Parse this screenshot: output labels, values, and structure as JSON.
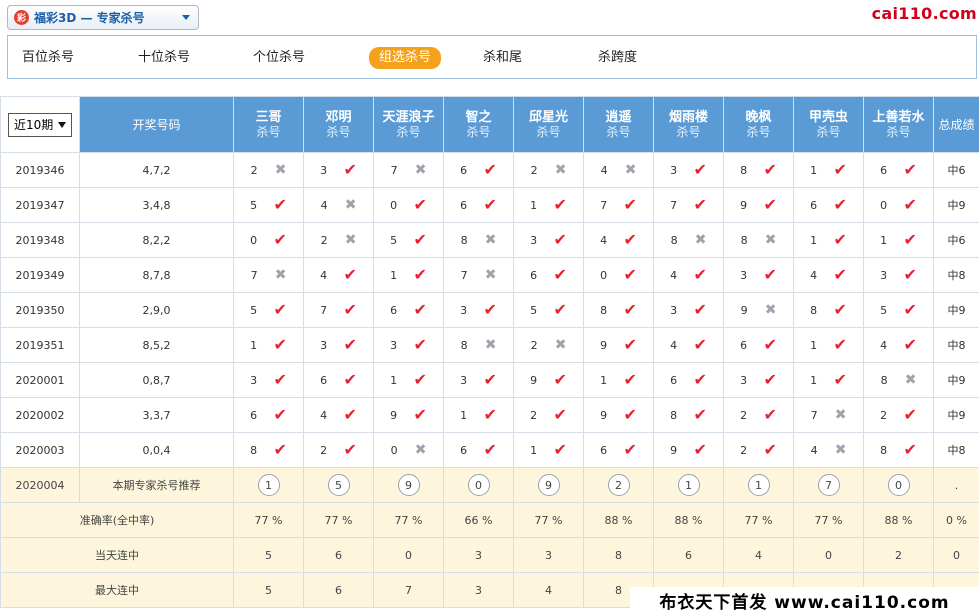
{
  "header": {
    "logo_char": "彩",
    "selector_title": "福彩3D — 专家杀号",
    "brand": "cai110.com"
  },
  "tabs": [
    {
      "label": "百位杀号",
      "active": false
    },
    {
      "label": "十位杀号",
      "active": false
    },
    {
      "label": "个位杀号",
      "active": false
    },
    {
      "label": "组选杀号",
      "active": true
    },
    {
      "label": "杀和尾",
      "active": false
    },
    {
      "label": "杀跨度",
      "active": false
    }
  ],
  "table": {
    "period_select": "近10期",
    "draw_header": "开奖号码",
    "total_header": "总成绩",
    "experts": [
      {
        "name": "三哥",
        "sub": "杀号"
      },
      {
        "name": "邓明",
        "sub": "杀号"
      },
      {
        "name": "天涯浪子",
        "sub": "杀号"
      },
      {
        "name": "智之",
        "sub": "杀号"
      },
      {
        "name": "邱星光",
        "sub": "杀号"
      },
      {
        "name": "逍遥",
        "sub": "杀号"
      },
      {
        "name": "烟雨楼",
        "sub": "杀号"
      },
      {
        "name": "晚枫",
        "sub": "杀号"
      },
      {
        "name": "甲壳虫",
        "sub": "杀号"
      },
      {
        "name": "上善若水",
        "sub": "杀号"
      }
    ],
    "rows": [
      {
        "period": "2019346",
        "draw": "4,7,2",
        "total": "中6",
        "cells": [
          {
            "n": "2",
            "ok": false
          },
          {
            "n": "3",
            "ok": true
          },
          {
            "n": "7",
            "ok": false
          },
          {
            "n": "6",
            "ok": true
          },
          {
            "n": "2",
            "ok": false
          },
          {
            "n": "4",
            "ok": false
          },
          {
            "n": "3",
            "ok": true
          },
          {
            "n": "8",
            "ok": true
          },
          {
            "n": "1",
            "ok": true
          },
          {
            "n": "6",
            "ok": true
          }
        ]
      },
      {
        "period": "2019347",
        "draw": "3,4,8",
        "total": "中9",
        "cells": [
          {
            "n": "5",
            "ok": true
          },
          {
            "n": "4",
            "ok": false
          },
          {
            "n": "0",
            "ok": true
          },
          {
            "n": "6",
            "ok": true
          },
          {
            "n": "1",
            "ok": true
          },
          {
            "n": "7",
            "ok": true
          },
          {
            "n": "7",
            "ok": true
          },
          {
            "n": "9",
            "ok": true
          },
          {
            "n": "6",
            "ok": true
          },
          {
            "n": "0",
            "ok": true
          }
        ]
      },
      {
        "period": "2019348",
        "draw": "8,2,2",
        "total": "中6",
        "cells": [
          {
            "n": "0",
            "ok": true
          },
          {
            "n": "2",
            "ok": false
          },
          {
            "n": "5",
            "ok": true
          },
          {
            "n": "8",
            "ok": false
          },
          {
            "n": "3",
            "ok": true
          },
          {
            "n": "4",
            "ok": true
          },
          {
            "n": "8",
            "ok": false
          },
          {
            "n": "8",
            "ok": false
          },
          {
            "n": "1",
            "ok": true
          },
          {
            "n": "1",
            "ok": true
          }
        ]
      },
      {
        "period": "2019349",
        "draw": "8,7,8",
        "total": "中8",
        "cells": [
          {
            "n": "7",
            "ok": false
          },
          {
            "n": "4",
            "ok": true
          },
          {
            "n": "1",
            "ok": true
          },
          {
            "n": "7",
            "ok": false
          },
          {
            "n": "6",
            "ok": true
          },
          {
            "n": "0",
            "ok": true
          },
          {
            "n": "4",
            "ok": true
          },
          {
            "n": "3",
            "ok": true
          },
          {
            "n": "4",
            "ok": true
          },
          {
            "n": "3",
            "ok": true
          }
        ]
      },
      {
        "period": "2019350",
        "draw": "2,9,0",
        "total": "中9",
        "cells": [
          {
            "n": "5",
            "ok": true
          },
          {
            "n": "7",
            "ok": true
          },
          {
            "n": "6",
            "ok": true
          },
          {
            "n": "3",
            "ok": true
          },
          {
            "n": "5",
            "ok": true
          },
          {
            "n": "8",
            "ok": true
          },
          {
            "n": "3",
            "ok": true
          },
          {
            "n": "9",
            "ok": false
          },
          {
            "n": "8",
            "ok": true
          },
          {
            "n": "5",
            "ok": true
          }
        ]
      },
      {
        "period": "2019351",
        "draw": "8,5,2",
        "total": "中8",
        "cells": [
          {
            "n": "1",
            "ok": true
          },
          {
            "n": "3",
            "ok": true
          },
          {
            "n": "3",
            "ok": true
          },
          {
            "n": "8",
            "ok": false
          },
          {
            "n": "2",
            "ok": false
          },
          {
            "n": "9",
            "ok": true
          },
          {
            "n": "4",
            "ok": true
          },
          {
            "n": "6",
            "ok": true
          },
          {
            "n": "1",
            "ok": true
          },
          {
            "n": "4",
            "ok": true
          }
        ]
      },
      {
        "period": "2020001",
        "draw": "0,8,7",
        "total": "中9",
        "cells": [
          {
            "n": "3",
            "ok": true
          },
          {
            "n": "6",
            "ok": true
          },
          {
            "n": "1",
            "ok": true
          },
          {
            "n": "3",
            "ok": true
          },
          {
            "n": "9",
            "ok": true
          },
          {
            "n": "1",
            "ok": true
          },
          {
            "n": "6",
            "ok": true
          },
          {
            "n": "3",
            "ok": true
          },
          {
            "n": "1",
            "ok": true
          },
          {
            "n": "8",
            "ok": false
          }
        ]
      },
      {
        "period": "2020002",
        "draw": "3,3,7",
        "total": "中9",
        "cells": [
          {
            "n": "6",
            "ok": true
          },
          {
            "n": "4",
            "ok": true
          },
          {
            "n": "9",
            "ok": true
          },
          {
            "n": "1",
            "ok": true
          },
          {
            "n": "2",
            "ok": true
          },
          {
            "n": "9",
            "ok": true
          },
          {
            "n": "8",
            "ok": true
          },
          {
            "n": "2",
            "ok": true
          },
          {
            "n": "7",
            "ok": false
          },
          {
            "n": "2",
            "ok": true
          }
        ]
      },
      {
        "period": "2020003",
        "draw": "0,0,4",
        "total": "中8",
        "cells": [
          {
            "n": "8",
            "ok": true
          },
          {
            "n": "2",
            "ok": true
          },
          {
            "n": "0",
            "ok": false
          },
          {
            "n": "6",
            "ok": true
          },
          {
            "n": "1",
            "ok": true
          },
          {
            "n": "6",
            "ok": true
          },
          {
            "n": "9",
            "ok": true
          },
          {
            "n": "2",
            "ok": true
          },
          {
            "n": "4",
            "ok": false
          },
          {
            "n": "8",
            "ok": true
          }
        ]
      }
    ],
    "recommend": {
      "period": "2020004",
      "label": "本期专家杀号推荐",
      "values": [
        "1",
        "5",
        "9",
        "0",
        "9",
        "2",
        "1",
        "1",
        "7",
        "0"
      ],
      "total": "."
    },
    "accuracy": {
      "label": "准确率(全中率)",
      "values": [
        "77 %",
        "77 %",
        "77 %",
        "66 %",
        "77 %",
        "88 %",
        "88 %",
        "77 %",
        "77 %",
        "88 %"
      ],
      "total": "0 %"
    },
    "current_streak": {
      "label": "当天连中",
      "values": [
        "5",
        "6",
        "0",
        "3",
        "3",
        "8",
        "6",
        "4",
        "0",
        "2"
      ],
      "total": "0"
    },
    "max_streak": {
      "label": "最大连中",
      "values": [
        "5",
        "6",
        "7",
        "3",
        "4",
        "8",
        "",
        "",
        "",
        "",
        ""
      ],
      "total": ""
    }
  },
  "watermark": "布衣天下首发 www.cai110.com"
}
